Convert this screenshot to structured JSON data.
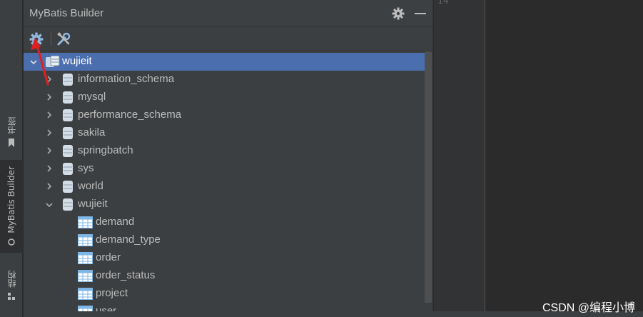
{
  "window": {
    "title": "MyBatis Builder"
  },
  "side_tabs": [
    {
      "label": "书签"
    },
    {
      "label": "MyBatis Builder"
    },
    {
      "label": "结构"
    }
  ],
  "toolbar": {
    "settings_icon": "gear-icon",
    "tools_icon": "wrench-icon"
  },
  "tree": {
    "root": "wujieit",
    "databases": [
      {
        "label": "information_schema",
        "expanded": false
      },
      {
        "label": "mysql",
        "expanded": false
      },
      {
        "label": "performance_schema",
        "expanded": false
      },
      {
        "label": "sakila",
        "expanded": false
      },
      {
        "label": "springbatch",
        "expanded": false
      },
      {
        "label": "sys",
        "expanded": false
      },
      {
        "label": "world",
        "expanded": false
      },
      {
        "label": "wujieit",
        "expanded": true
      }
    ],
    "tables": [
      {
        "label": "demand"
      },
      {
        "label": "demand_type"
      },
      {
        "label": "order"
      },
      {
        "label": "order_status"
      },
      {
        "label": "project"
      },
      {
        "label": "user"
      }
    ]
  },
  "editor": {
    "line_number": "14"
  },
  "watermark": "CSDN @编程小博",
  "colors": {
    "selection": "#4b6eaf",
    "panel": "#3c3f41",
    "arrow": "#e02020",
    "icon_blue": "#7eb6e6"
  }
}
